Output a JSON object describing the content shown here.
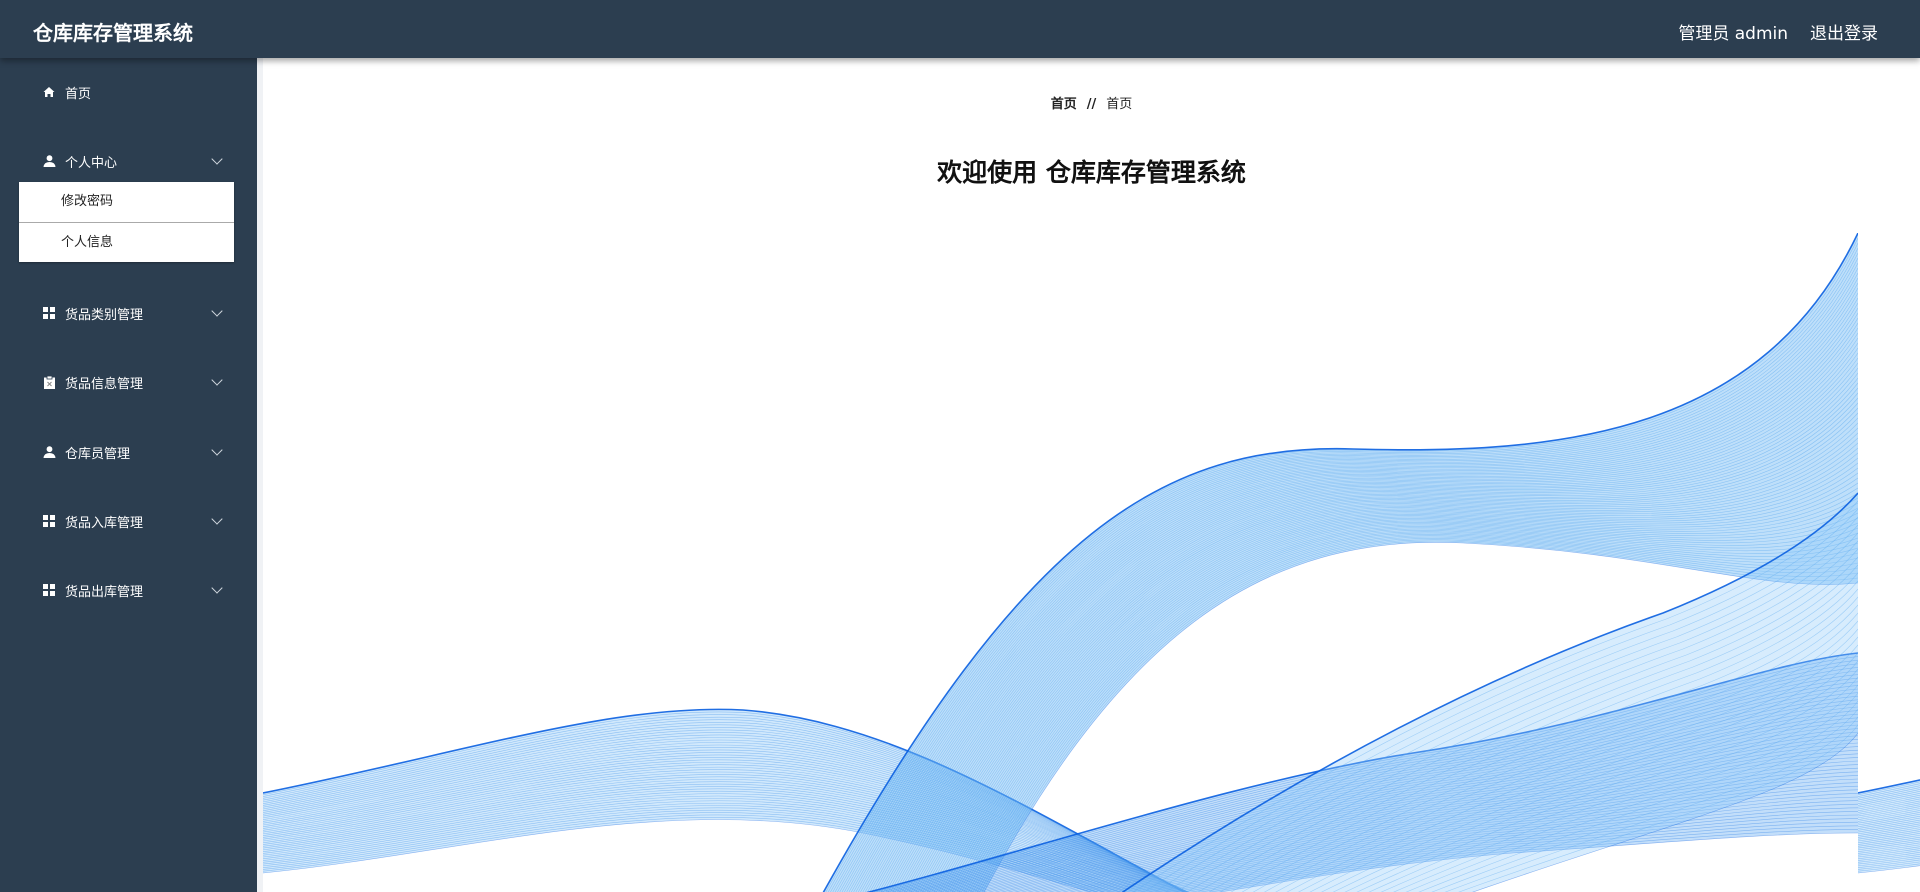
{
  "header": {
    "title": "仓库库存管理系统",
    "user": "管理员 admin",
    "logout": "退出登录"
  },
  "sidebar": {
    "items": [
      {
        "label": "首页",
        "icon": "home-icon"
      },
      {
        "label": "个人中心",
        "icon": "user-icon",
        "submenu": [
          "修改密码",
          "个人信息"
        ]
      },
      {
        "label": "货品类别管理",
        "icon": "grid-icon"
      },
      {
        "label": "货品信息管理",
        "icon": "clipboard-icon"
      },
      {
        "label": "仓库员管理",
        "icon": "user-icon"
      },
      {
        "label": "货品入库管理",
        "icon": "grid-icon"
      },
      {
        "label": "货品出库管理",
        "icon": "grid-icon"
      }
    ]
  },
  "main": {
    "breadcrumb": [
      "首页",
      "//",
      "首页"
    ],
    "welcome": "欢迎使用 仓库库存管理系统"
  },
  "colors": {
    "header": "#2c3e50",
    "sidebar": "#2c3e50",
    "wave": "#4da3f0"
  }
}
